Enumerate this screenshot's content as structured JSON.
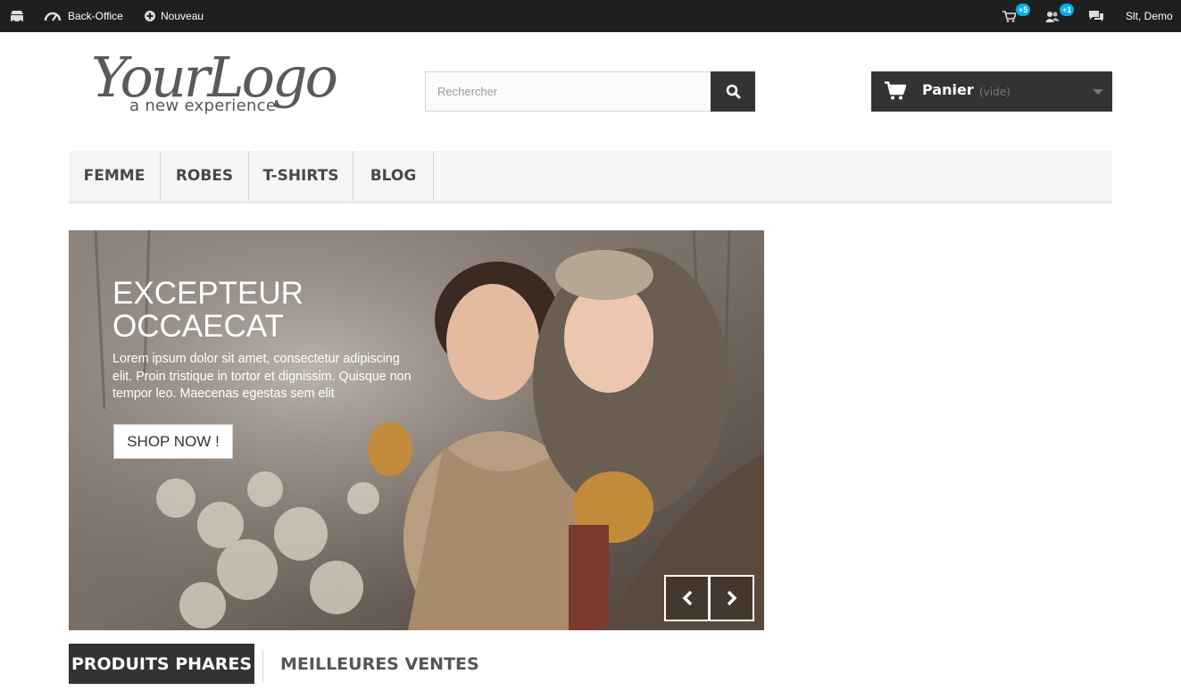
{
  "adminbar": {
    "back_office": "Back-Office",
    "nouveau": "Nouveau",
    "orders_badge": "+5",
    "customers_badge": "+1",
    "user": "Slt, Demo"
  },
  "logo": {
    "main": "YourLogo",
    "tagline": "a new experience"
  },
  "search": {
    "placeholder": "Rechercher"
  },
  "cart": {
    "label": "Panier",
    "status": "(vide)"
  },
  "menu": {
    "items": [
      "FEMME",
      "ROBES",
      "T-SHIRTS",
      "BLOG"
    ]
  },
  "slider": {
    "title_line1": "EXCEPTEUR",
    "title_line2": "OCCAECAT",
    "text": "Lorem ipsum dolor sit amet, consectetur adipiscing elit. Proin tristique in tortor et dignissim. Quisque non tempor leo. Maecenas egestas sem elit",
    "button": "SHOP NOW !"
  },
  "tabs": {
    "active": "PRODUITS PHARES",
    "inactive": "MEILLEURES VENTES"
  },
  "colors": {
    "adminbar": "#1f1f1f",
    "dark": "#333333",
    "badge": "#00aff0",
    "menu_bg": "#f6f6f6"
  }
}
